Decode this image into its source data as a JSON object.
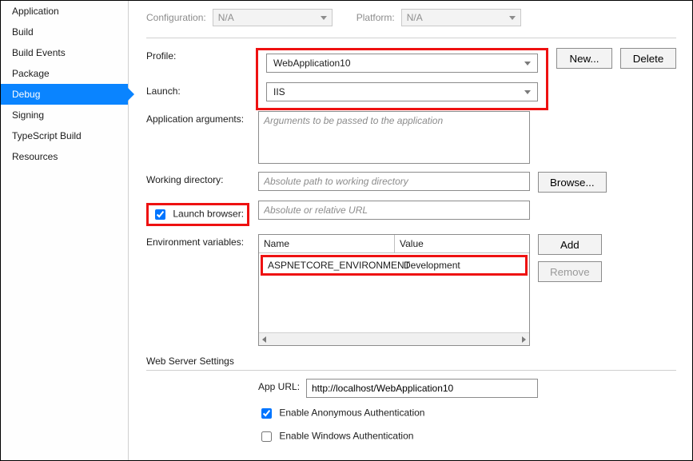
{
  "sidebar": {
    "items": [
      {
        "label": "Application"
      },
      {
        "label": "Build"
      },
      {
        "label": "Build Events"
      },
      {
        "label": "Package"
      },
      {
        "label": "Debug"
      },
      {
        "label": "Signing"
      },
      {
        "label": "TypeScript Build"
      },
      {
        "label": "Resources"
      }
    ]
  },
  "top": {
    "config_label": "Configuration:",
    "config_value": "N/A",
    "platform_label": "Platform:",
    "platform_value": "N/A"
  },
  "profile": {
    "label": "Profile:",
    "value": "WebApplication10",
    "new_btn": "New...",
    "delete_btn": "Delete"
  },
  "launch": {
    "label": "Launch:",
    "value": "IIS"
  },
  "appargs": {
    "label": "Application arguments:",
    "placeholder": "Arguments to be passed to the application"
  },
  "workdir": {
    "label": "Working directory:",
    "placeholder": "Absolute path to working directory",
    "browse_btn": "Browse..."
  },
  "launch_browser": {
    "label": "Launch browser:",
    "placeholder": "Absolute or relative URL"
  },
  "env": {
    "label": "Environment variables:",
    "col_name": "Name",
    "col_value": "Value",
    "rows": [
      {
        "name": "ASPNETCORE_ENVIRONMENT",
        "value": "Development"
      }
    ],
    "add_btn": "Add",
    "remove_btn": "Remove"
  },
  "webserver": {
    "header": "Web Server Settings",
    "appurl_label": "App URL:",
    "appurl_value": "http://localhost/WebApplication10",
    "anon_label": "Enable Anonymous Authentication",
    "win_label": "Enable Windows Authentication"
  }
}
